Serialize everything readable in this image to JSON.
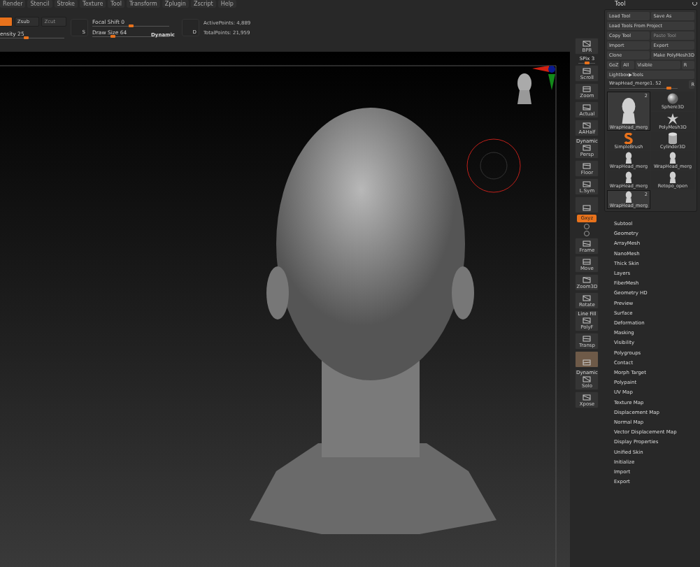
{
  "menu": [
    "Render",
    "Stencil",
    "Stroke",
    "Texture",
    "Tool",
    "Transform",
    "Zplugin",
    "Zscript",
    "Help"
  ],
  "toolbar": {
    "modes": [
      {
        "kind": "color",
        "selected": true
      },
      {
        "kind": "text",
        "label": "Zsub",
        "selected": false,
        "disabled": false
      },
      {
        "kind": "text",
        "label": "Zcut",
        "selected": false,
        "disabled": true
      }
    ],
    "intensity": {
      "label": "ensity 25",
      "level": 0.4
    },
    "brush_letter": "S",
    "focal_shift": {
      "label": "Focal Shift 0",
      "level": 0.5
    },
    "draw_size": {
      "label": "Draw Size 64",
      "level": 0.25
    },
    "dynamic": "Dynamic",
    "stroke_letter": "D",
    "active_points": "ActivePoints: 4,889",
    "total_points": "TotalPoints: 21,959"
  },
  "shelf": [
    {
      "kind": "button",
      "label": "BPR",
      "selected": false
    },
    {
      "kind": "slider",
      "label": "SPix 3",
      "level": 0.5
    },
    {
      "kind": "button",
      "label": "Scroll",
      "selected": false
    },
    {
      "kind": "button",
      "label": "Zoom",
      "selected": false
    },
    {
      "kind": "button",
      "label": "Actual",
      "selected": false
    },
    {
      "kind": "button",
      "label": "AAHalf",
      "selected": false
    },
    {
      "kind": "button",
      "label": "Persp",
      "top": "Dynamic",
      "selected": false
    },
    {
      "kind": "button",
      "label": "Floor",
      "selected": false
    },
    {
      "kind": "button",
      "label": "L.Sym",
      "selected": false
    },
    {
      "kind": "button",
      "selected": false
    },
    {
      "kind": "toggle",
      "label": "Gxyz",
      "selected": true
    },
    {
      "kind": "mini"
    },
    {
      "kind": "mini"
    },
    {
      "kind": "button",
      "label": "Frame",
      "selected": false
    },
    {
      "kind": "button",
      "label": "Move",
      "selected": false
    },
    {
      "kind": "button",
      "label": "Zoom3D",
      "selected": false
    },
    {
      "kind": "button",
      "label": "Rotate",
      "selected": false
    },
    {
      "kind": "button",
      "label": "PolyF",
      "top": "Line Fill",
      "selected": false
    },
    {
      "kind": "button",
      "label": "Transp",
      "selected": false
    },
    {
      "kind": "button",
      "selected": true
    },
    {
      "kind": "button",
      "label": "Solo",
      "top": "Dynamic",
      "selected": false
    },
    {
      "kind": "button",
      "label": "Xpose",
      "selected": false
    }
  ],
  "tool_panel": {
    "title": "Tool",
    "button_rows": [
      [
        {
          "label": "Load Tool",
          "disabled": false
        },
        {
          "label": "Save As",
          "disabled": false
        }
      ],
      [
        {
          "label": "Load Tools From Project",
          "disabled": false
        }
      ],
      [
        {
          "label": "Copy Tool",
          "disabled": false
        },
        {
          "label": "Paste Tool",
          "disabled": true
        }
      ],
      [
        {
          "label": "Import",
          "disabled": false
        },
        {
          "label": "Export",
          "disabled": false
        }
      ],
      [
        {
          "label": "Clone",
          "disabled": false
        },
        {
          "label": "Make PolyMesh3D",
          "disabled": false
        }
      ],
      [
        {
          "label": "GoZ",
          "disabled": false
        },
        {
          "label": "All",
          "disabled": false
        },
        {
          "label": "Visible",
          "disabled": false
        },
        {
          "label": "R",
          "disabled": false
        }
      ],
      [
        {
          "label": "Lightbox▶Tools",
          "disabled": false
        }
      ]
    ],
    "slider": {
      "label": "WrapHead_merge1. 52",
      "level": 0.9,
      "reset": "R"
    },
    "tools": [
      {
        "kind": "large-head",
        "label": "WrapHead_merg",
        "count": "2",
        "selected": true
      },
      {
        "kind": "sphere",
        "label": "Sphere3D",
        "selected": false
      },
      {
        "kind": "star",
        "label": "PolyMesh3D",
        "selected": false
      },
      {
        "kind": "brush",
        "label": "SimpleBrush",
        "selected": false
      },
      {
        "kind": "cylinder",
        "label": "Cylinder3D",
        "selected": false
      },
      {
        "kind": "head",
        "label": "WrapHead_merg",
        "selected": false
      },
      {
        "kind": "head",
        "label": "WrapHead_merg",
        "selected": false
      },
      {
        "kind": "head",
        "label": "WrapHead_merg",
        "selected": false
      },
      {
        "kind": "head",
        "label": "Retopo_open",
        "selected": false
      },
      {
        "kind": "head",
        "label": "WrapHead_merg",
        "count": "2",
        "selected": true
      }
    ],
    "subpalettes": [
      "Subtool",
      "Geometry",
      "ArrayMesh",
      "NanoMesh",
      "Thick Skin",
      "Layers",
      "FiberMesh",
      "Geometry HD",
      "Preview",
      "Surface",
      "Deformation",
      "Masking",
      "Visibility",
      "Polygroups",
      "Contact",
      "Morph Target",
      "Polypaint",
      "UV Map",
      "Texture Map",
      "Displacement Map",
      "Normal Map",
      "Vector Displacement Map",
      "Display Properties",
      "Unified Skin",
      "Initialize",
      "Import",
      "Export"
    ]
  }
}
